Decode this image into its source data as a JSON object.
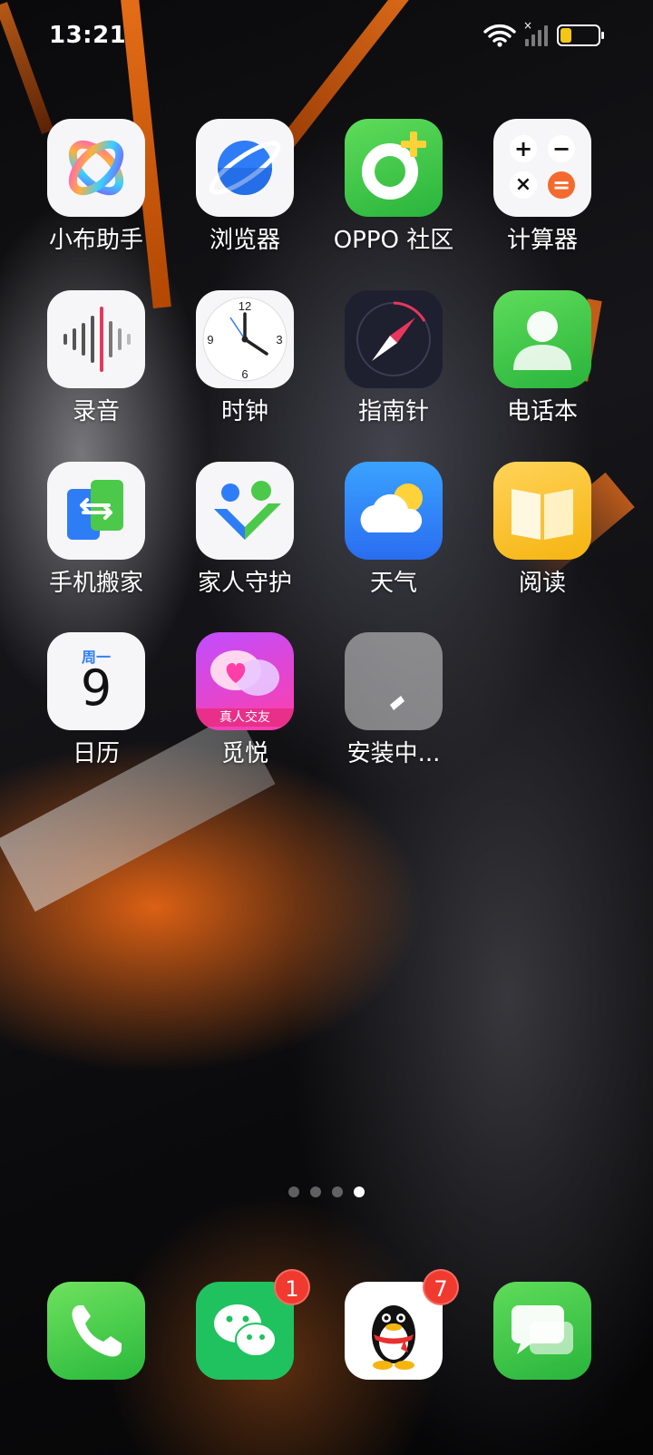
{
  "status_bar": {
    "time": "13:21",
    "battery_level": 0.3
  },
  "apps": [
    {
      "name": "xiaobu-assistant",
      "label": "小布助手"
    },
    {
      "name": "browser",
      "label": "浏览器"
    },
    {
      "name": "oppo-community",
      "label": "OPPO 社区"
    },
    {
      "name": "calculator",
      "label": "计算器"
    },
    {
      "name": "recorder",
      "label": "录音"
    },
    {
      "name": "clock",
      "label": "时钟"
    },
    {
      "name": "compass",
      "label": "指南针"
    },
    {
      "name": "phonebook",
      "label": "电话本"
    },
    {
      "name": "phone-clone",
      "label": "手机搬家"
    },
    {
      "name": "family-guard",
      "label": "家人守护"
    },
    {
      "name": "weather",
      "label": "天气"
    },
    {
      "name": "reader",
      "label": "阅读"
    },
    {
      "name": "calendar",
      "label": "日历",
      "weekday": "周一",
      "day": "9"
    },
    {
      "name": "miyue",
      "label": "觅悦",
      "tag": "真人交友"
    },
    {
      "name": "installing-app",
      "label": "安装中..."
    }
  ],
  "clock_numbers": [
    "12",
    "3",
    "6",
    "9"
  ],
  "calculator_symbols": [
    "+",
    "−",
    "×",
    "="
  ],
  "pager": {
    "pages": 4,
    "current": 4
  },
  "dock": [
    {
      "name": "phone",
      "badge": ""
    },
    {
      "name": "wechat",
      "badge": "1"
    },
    {
      "name": "qq",
      "badge": "7"
    },
    {
      "name": "messages",
      "badge": ""
    }
  ]
}
